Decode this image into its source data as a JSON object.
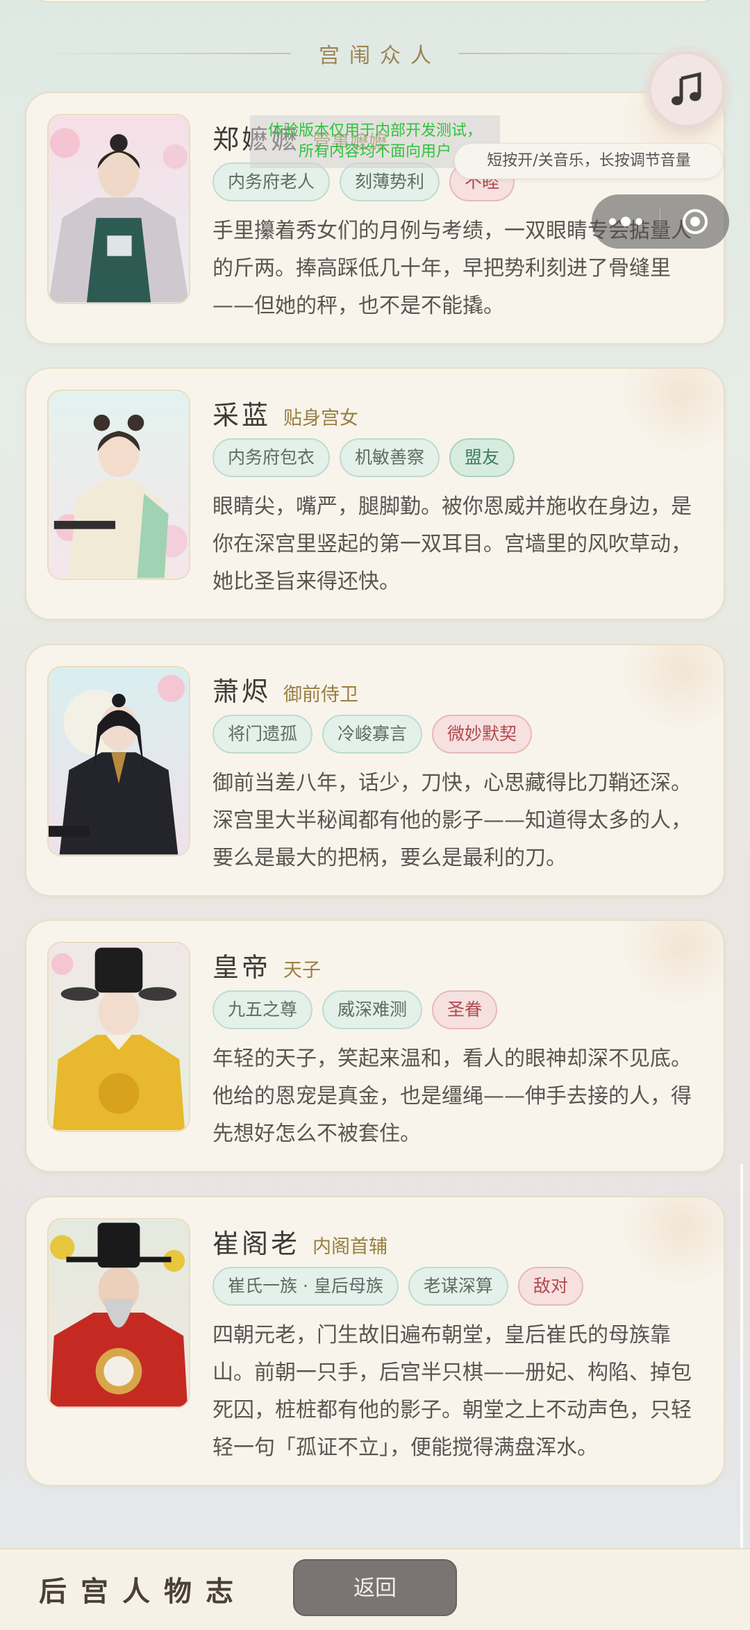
{
  "section": {
    "title": "宫闱众人"
  },
  "characters": [
    {
      "name": "郑嬷嬷",
      "role": "管事嬷嬷",
      "tags": [
        {
          "label": "内务府老人",
          "tone": "normal"
        },
        {
          "label": "刻薄势利",
          "tone": "normal"
        },
        {
          "label": "不睦",
          "tone": "red"
        }
      ],
      "description": "手里攥着秀女们的月例与考绩，一双眼睛专会掂量人的斤两。捧高踩低几十年，早把势利刻进了骨缝里——但她的秤，也不是不能撬。",
      "portrait_icon": "elderly-court-matron-portrait"
    },
    {
      "name": "采蓝",
      "role": "贴身宫女",
      "tags": [
        {
          "label": "内务府包衣",
          "tone": "normal"
        },
        {
          "label": "机敏善察",
          "tone": "normal"
        },
        {
          "label": "盟友",
          "tone": "green"
        }
      ],
      "description": "眼睛尖，嘴严，腿脚勤。被你恩威并施收在身边，是你在深宫里竖起的第一双耳目。宫墙里的风吹草动，她比圣旨来得还快。",
      "portrait_icon": "palace-maid-portrait"
    },
    {
      "name": "萧烬",
      "role": "御前侍卫",
      "tags": [
        {
          "label": "将门遗孤",
          "tone": "normal"
        },
        {
          "label": "冷峻寡言",
          "tone": "normal"
        },
        {
          "label": "微妙默契",
          "tone": "red"
        }
      ],
      "description": "御前当差八年，话少，刀快，心思藏得比刀鞘还深。深宫里大半秘闻都有他的影子——知道得太多的人，要么是最大的把柄，要么是最利的刀。",
      "portrait_icon": "imperial-guard-portrait"
    },
    {
      "name": "皇帝",
      "role": "天子",
      "tags": [
        {
          "label": "九五之尊",
          "tone": "normal"
        },
        {
          "label": "威深难测",
          "tone": "normal"
        },
        {
          "label": "圣眷",
          "tone": "red"
        }
      ],
      "description": "年轻的天子，笑起来温和，看人的眼神却深不见底。他给的恩宠是真金，也是缰绳——伸手去接的人，得先想好怎么不被套住。",
      "portrait_icon": "emperor-portrait"
    },
    {
      "name": "崔阁老",
      "role": "内阁首辅",
      "tags": [
        {
          "label": "崔氏一族 · 皇后母族",
          "tone": "normal"
        },
        {
          "label": "老谋深算",
          "tone": "normal"
        },
        {
          "label": "敌对",
          "tone": "red"
        }
      ],
      "description": "四朝元老，门生故旧遍布朝堂，皇后崔氏的母族靠山。前朝一只手，后宫半只棋——册妃、构陷、掉包死囚，桩桩都有他的影子。朝堂之上不动声色，只轻轻一句「孤证不立」，便能搅得满盘浑水。",
      "portrait_icon": "grand-secretary-portrait"
    }
  ],
  "music": {
    "tip": "短按开/关音乐，长按调节音量",
    "icon": "music-note-icon"
  },
  "watermark": {
    "line1": "体验版本仅用于内部开发测试，",
    "line2": "所有内容均不面向用户"
  },
  "capsule": {
    "more_icon": "more-dots-icon",
    "close_icon": "close-target-icon"
  },
  "footer": {
    "title": "后宫人物志",
    "back_label": "返回"
  },
  "colors": {
    "accent_gold": "#9a7e40",
    "tag_green": "#3f7d5c",
    "tag_red": "#b04a4e",
    "card_bg": "#f8f4ec"
  }
}
